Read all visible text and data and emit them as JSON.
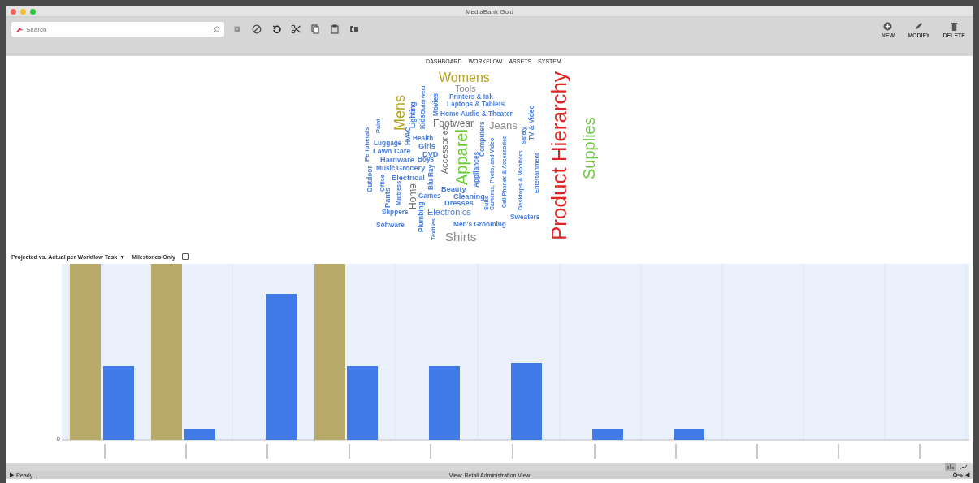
{
  "window": {
    "title": "MediaBank Gold"
  },
  "toolbar": {
    "search": {
      "placeholder": "Search"
    },
    "actions": [
      {
        "label": "NEW",
        "kind": "new"
      },
      {
        "label": "MODIFY",
        "kind": "modify"
      },
      {
        "label": "DELETE",
        "kind": "delete"
      }
    ]
  },
  "nav": [
    "DASHBOARD",
    "WORKFLOW",
    "ASSETS",
    "SYSTEM"
  ],
  "word_cloud": [
    {
      "text": "Womens",
      "color": "#b8a21e",
      "kind": "horizontal"
    },
    {
      "text": "Tools",
      "color": "#8a8a8a",
      "kind": "horizontal"
    },
    {
      "text": "Printers & Ink",
      "color": "#4a7fe0",
      "kind": "horizontal"
    },
    {
      "text": "Laptops & Tablets",
      "color": "#4a7fe0",
      "kind": "horizontal"
    },
    {
      "text": "Home Audio & Theater",
      "color": "#4a7fe0",
      "kind": "horizontal"
    },
    {
      "text": "Mens",
      "color": "#b8a21e",
      "kind": "vertical"
    },
    {
      "text": "Lighting",
      "color": "#4a7fe0",
      "kind": "vertical"
    },
    {
      "text": "Kids",
      "color": "#4a7fe0",
      "kind": "vertical"
    },
    {
      "text": "Outerwear",
      "color": "#4a7fe0",
      "kind": "vertical"
    },
    {
      "text": "Movies",
      "color": "#4a7fe0",
      "kind": "vertical"
    },
    {
      "text": "Paint",
      "color": "#4a7fe0",
      "kind": "vertical"
    },
    {
      "text": "Peripherals",
      "color": "#4a7fe0",
      "kind": "vertical"
    },
    {
      "text": "HVAC",
      "color": "#4a7fe0",
      "kind": "vertical"
    },
    {
      "text": "Footwear",
      "color": "#6e6e6e",
      "kind": "horizontal"
    },
    {
      "text": "Health",
      "color": "#4a7fe0",
      "kind": "horizontal"
    },
    {
      "text": "Girls",
      "color": "#4a7fe0",
      "kind": "horizontal"
    },
    {
      "text": "Luggage",
      "color": "#4a7fe0",
      "kind": "horizontal"
    },
    {
      "text": "Lawn Care",
      "color": "#4a7fe0",
      "kind": "horizontal"
    },
    {
      "text": "DVD",
      "color": "#4a7fe0",
      "kind": "horizontal"
    },
    {
      "text": "Hardware",
      "color": "#4a7fe0",
      "kind": "horizontal"
    },
    {
      "text": "Boys",
      "color": "#4a7fe0",
      "kind": "horizontal"
    },
    {
      "text": "Music",
      "color": "#4a7fe0",
      "kind": "horizontal"
    },
    {
      "text": "Grocery",
      "color": "#4a7fe0",
      "kind": "horizontal"
    },
    {
      "text": "Electrical",
      "color": "#4a7fe0",
      "kind": "horizontal"
    },
    {
      "text": "Outdoor",
      "color": "#4a7fe0",
      "kind": "vertical"
    },
    {
      "text": "Office",
      "color": "#4a7fe0",
      "kind": "vertical"
    },
    {
      "text": "Accessories",
      "color": "#6e6e6e",
      "kind": "vertical"
    },
    {
      "text": "Apparel",
      "color": "#6cc93c",
      "kind": "vertical"
    },
    {
      "text": "Blu-Ray",
      "color": "#4a7fe0",
      "kind": "vertical"
    },
    {
      "text": "Computers",
      "color": "#4a7fe0",
      "kind": "vertical"
    },
    {
      "text": "Appliances",
      "color": "#4a7fe0",
      "kind": "vertical"
    },
    {
      "text": "Jeans",
      "color": "#8a8a8a",
      "kind": "horizontal"
    },
    {
      "text": "TV & Video",
      "color": "#4a7fe0",
      "kind": "vertical"
    },
    {
      "text": "Safety",
      "color": "#4a7fe0",
      "kind": "vertical"
    },
    {
      "text": "Desktops & Monitors",
      "color": "#4a7fe0",
      "kind": "vertical"
    },
    {
      "text": "Cell Phones & Accessories",
      "color": "#4a7fe0",
      "kind": "vertical"
    },
    {
      "text": "Entertainment",
      "color": "#4a7fe0",
      "kind": "vertical"
    },
    {
      "text": "Cameras, Photo, and Video",
      "color": "#4a7fe0",
      "kind": "vertical"
    },
    {
      "text": "Suits",
      "color": "#4a7fe0",
      "kind": "vertical"
    },
    {
      "text": "Home",
      "color": "#6e6e6e",
      "kind": "vertical"
    },
    {
      "text": "Pants",
      "color": "#4a7fe0",
      "kind": "vertical"
    },
    {
      "text": "Mattress",
      "color": "#4a7fe0",
      "kind": "vertical"
    },
    {
      "text": "Beauty",
      "color": "#4a7fe0",
      "kind": "horizontal"
    },
    {
      "text": "Cleaning",
      "color": "#4a7fe0",
      "kind": "horizontal"
    },
    {
      "text": "Games",
      "color": "#4a7fe0",
      "kind": "horizontal"
    },
    {
      "text": "Dresses",
      "color": "#4a7fe0",
      "kind": "horizontal"
    },
    {
      "text": "Slippers",
      "color": "#4a7fe0",
      "kind": "horizontal"
    },
    {
      "text": "Electronics",
      "color": "#4a7fe0",
      "kind": "horizontal"
    },
    {
      "text": "Sweaters",
      "color": "#4a7fe0",
      "kind": "horizontal"
    },
    {
      "text": "Software",
      "color": "#4a7fe0",
      "kind": "horizontal"
    },
    {
      "text": "Men's Grooming",
      "color": "#4a7fe0",
      "kind": "horizontal"
    },
    {
      "text": "Plumbing",
      "color": "#4a7fe0",
      "kind": "vertical"
    },
    {
      "text": "Textiles",
      "color": "#4a7fe0",
      "kind": "vertical"
    },
    {
      "text": "Shirts",
      "color": "#8a8a8a",
      "kind": "horizontal"
    },
    {
      "text": "Product Hierarchy",
      "color": "#e02424",
      "kind": "vertical"
    },
    {
      "text": "Supplies",
      "color": "#6cc93c",
      "kind": "vertical"
    }
  ],
  "chart_controls": {
    "dropdown": "Projected vs. Actual per Workflow Task",
    "dropdown_arrow": "▼",
    "milestones_label": "Milestones Only",
    "milestones_checked": false
  },
  "chart": {
    "y_tick": "0"
  },
  "status_bar": {
    "play": "▶",
    "text": "Ready...",
    "view": "View: Retail Administration View",
    "arrow": "◀"
  }
}
